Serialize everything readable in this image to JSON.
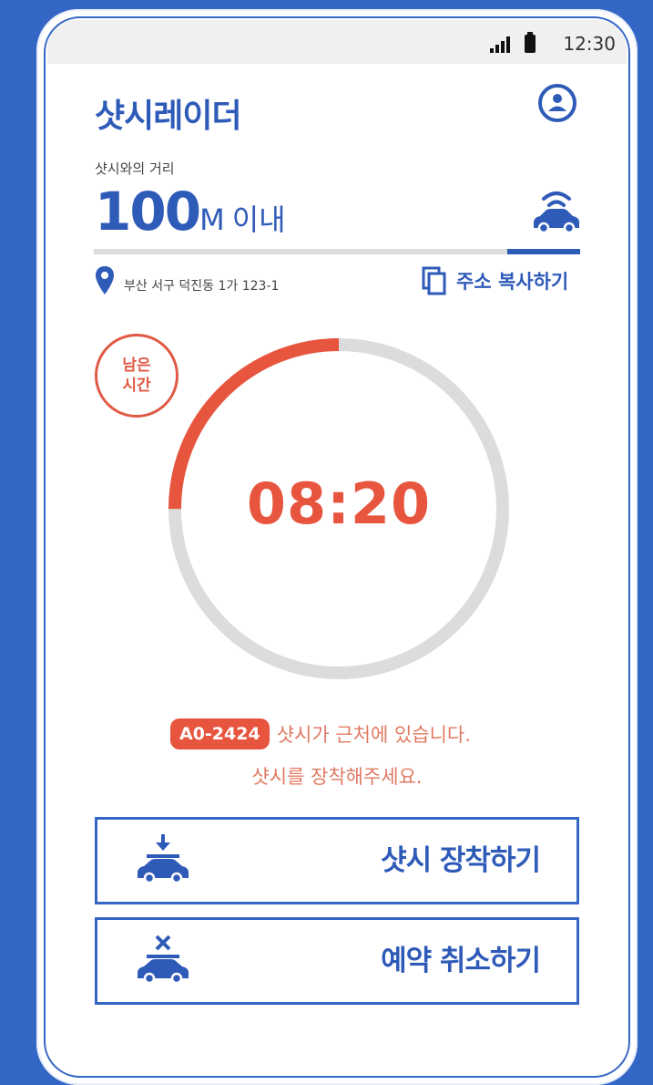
{
  "status_bar": {
    "time": "12:30"
  },
  "header": {
    "title": "샷시레이더",
    "profile_icon": "user-circle-icon"
  },
  "distance": {
    "label": "샷시와의 거리",
    "value": "100",
    "unit": "M",
    "suffix": "이내",
    "progress_percent": 15
  },
  "location": {
    "address": "부산 서구 덕진동 1가 123-1",
    "copy_label": "주소 복사하기"
  },
  "timer": {
    "badge_line1": "남은",
    "badge_line2": "시간",
    "remaining": "08:20",
    "elapsed_fraction": 0.25
  },
  "notice": {
    "plate": "A0-2424",
    "line1": "샷시가 근처에 있습니다.",
    "line2": "샷시를 장착해주세요."
  },
  "actions": {
    "attach_label": "샷시 장착하기",
    "cancel_label": "예약 취소하기"
  },
  "colors": {
    "brand": "#2f5bb8",
    "accent": "#e8553e",
    "track": "#dcdcdc",
    "background": "#3466c6"
  }
}
